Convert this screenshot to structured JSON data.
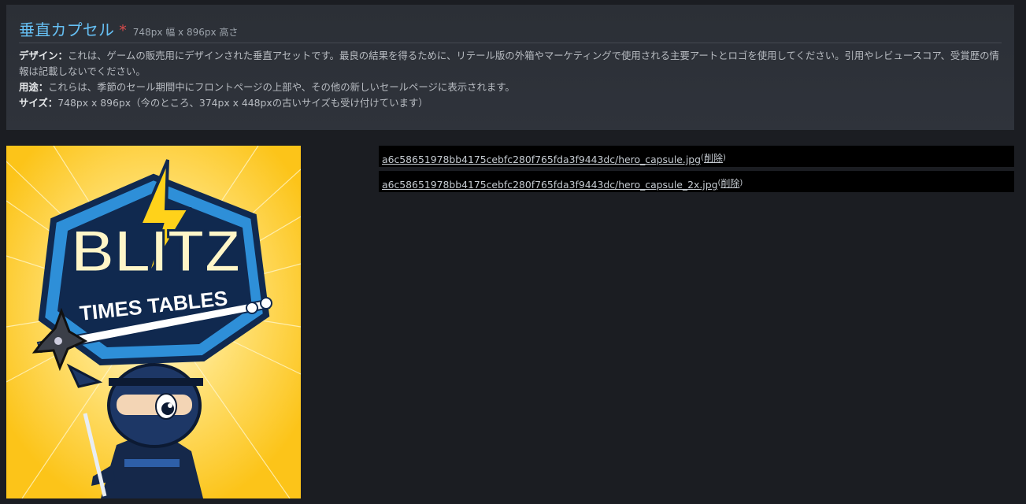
{
  "section": {
    "title": "垂直カプセル",
    "required_mark": "*",
    "dimensions": "748px 幅 x 896px 高さ"
  },
  "description": {
    "design_label": "デザイン：",
    "design_text": "これは、ゲームの販売用にデザインされた垂直アセットです。最良の結果を得るために、リテール版の外箱やマーケティングで使用される主要アートとロゴを使用してください。引用やレビュースコア、受賞歴の情報は記載しないでください。",
    "usage_label": "用途：",
    "usage_text": "これらは、季節のセール期間中にフロントページの上部や、その他の新しいセールページに表示されます。",
    "size_label": "サイズ：",
    "size_text": "748px x 896px（今のところ、374px x 448pxの古いサイズも受け付けています）"
  },
  "preview": {
    "logo_line1": "BLITZ",
    "logo_line2": "TIMES TABLES"
  },
  "files": [
    {
      "name": "a6c58651978bb4175cebfc280f765fda3f9443dc/hero_capsule.jpg",
      "delete_label": "削除"
    },
    {
      "name": "a6c58651978bb4175cebfc280f765fda3f9443dc/hero_capsule_2x.jpg",
      "delete_label": "削除"
    }
  ],
  "colors": {
    "title": "#66c0f4",
    "required": "#d94b4b",
    "preview_bg": "#fcc419",
    "logo_navy": "#10294f",
    "logo_blue": "#2e8fd8"
  }
}
